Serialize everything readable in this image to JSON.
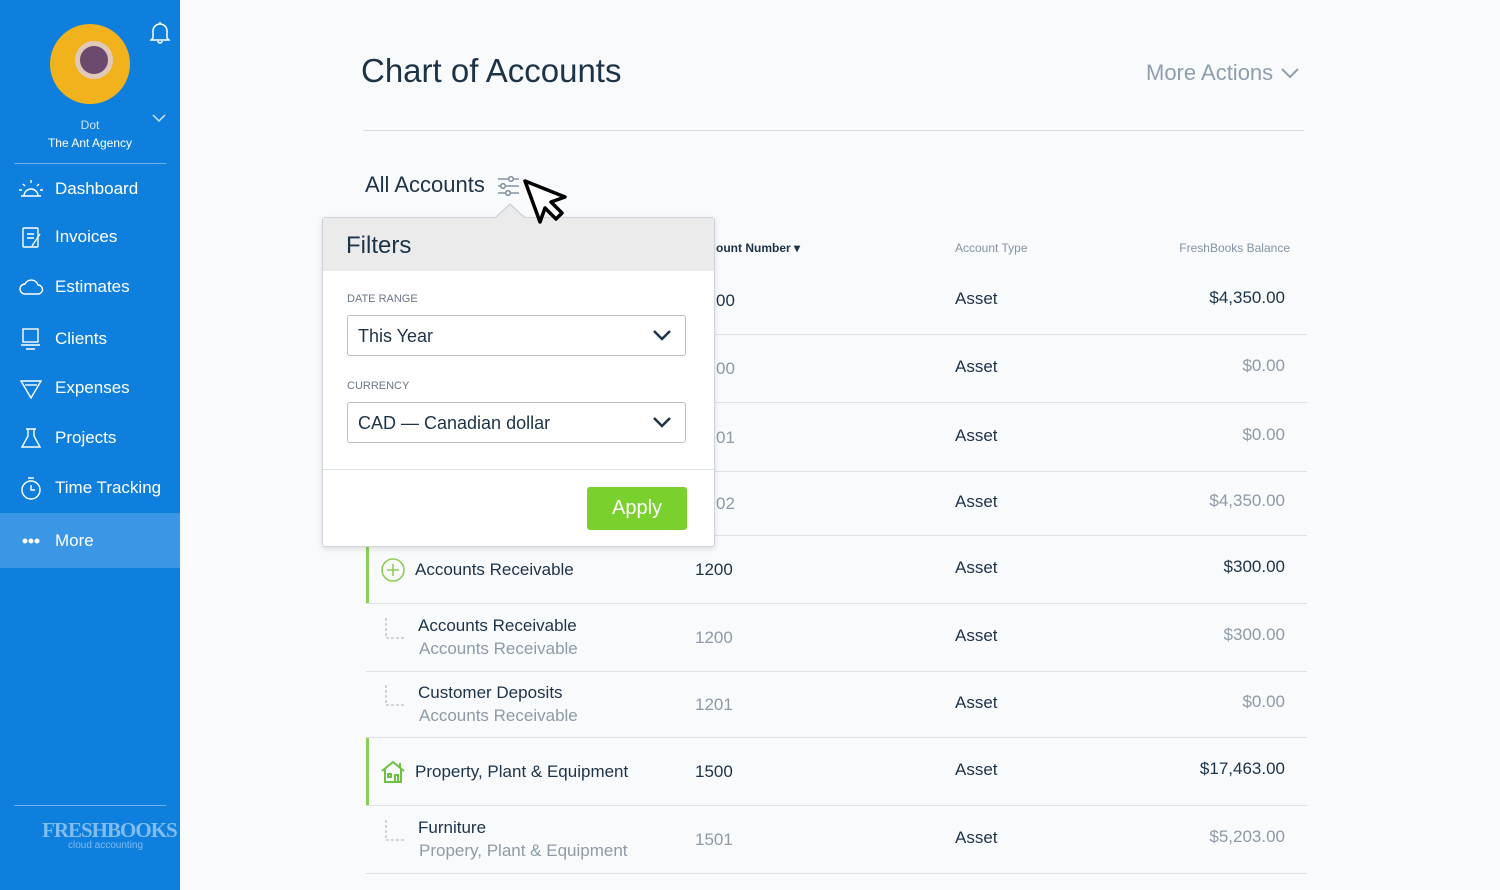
{
  "user": {
    "name": "Dot",
    "company": "The Ant Agency"
  },
  "sidebar": {
    "items": [
      {
        "label": "Dashboard",
        "icon": "dashboard-sun-icon"
      },
      {
        "label": "Invoices",
        "icon": "invoice-icon"
      },
      {
        "label": "Estimates",
        "icon": "estimate-cloud-icon"
      },
      {
        "label": "Clients",
        "icon": "clients-icon"
      },
      {
        "label": "Expenses",
        "icon": "expenses-icon"
      },
      {
        "label": "Projects",
        "icon": "flask-icon"
      },
      {
        "label": "Time Tracking",
        "icon": "stopwatch-icon"
      },
      {
        "label": "More",
        "icon": "more-dots-icon",
        "active": true
      }
    ],
    "logo": "FreshBooks",
    "logo_tagline": "cloud accounting"
  },
  "header": {
    "title": "Chart of Accounts",
    "more_actions": "More Actions"
  },
  "filter_bar": {
    "label": "All Accounts"
  },
  "table": {
    "columns": [
      "ount Number",
      "Account Type",
      "FreshBooks Balance"
    ],
    "rows": [
      {
        "name": "",
        "parent": "",
        "number": "00",
        "type": "Asset",
        "balance": "$4,350.00",
        "level": "top"
      },
      {
        "name": "",
        "parent": "",
        "number": "00",
        "type": "Asset",
        "balance": "$0.00",
        "level": "sub"
      },
      {
        "name": "",
        "parent": "",
        "number": "01",
        "type": "Asset",
        "balance": "$0.00",
        "level": "sub"
      },
      {
        "name": "",
        "parent": "",
        "number": "02",
        "type": "Asset",
        "balance": "$4,350.00",
        "level": "sub"
      },
      {
        "name": "Accounts Receivable",
        "parent": "",
        "number": "1200",
        "type": "Asset",
        "balance": "$300.00",
        "level": "top",
        "icon": "plus-circle-icon"
      },
      {
        "name": "Accounts Receivable",
        "parent": "Accounts Receivable",
        "number": "1200",
        "type": "Asset",
        "balance": "$300.00",
        "level": "sub"
      },
      {
        "name": "Customer Deposits",
        "parent": "Accounts Receivable",
        "number": "1201",
        "type": "Asset",
        "balance": "$0.00",
        "level": "sub"
      },
      {
        "name": "Property, Plant & Equipment",
        "parent": "",
        "number": "1500",
        "type": "Asset",
        "balance": "$17,463.00",
        "level": "top",
        "icon": "house-icon"
      },
      {
        "name": "Furniture",
        "parent": "Propery, Plant & Equipment",
        "number": "1501",
        "type": "Asset",
        "balance": "$5,203.00",
        "level": "sub"
      }
    ]
  },
  "filters": {
    "title": "Filters",
    "date_range_label": "DATE RANGE",
    "date_range_value": "This Year",
    "currency_label": "CURRENCY",
    "currency_value": "CAD — Canadian dollar",
    "apply": "Apply"
  },
  "colors": {
    "sidebar": "#0f7fde",
    "accent_green": "#7ad02c"
  }
}
